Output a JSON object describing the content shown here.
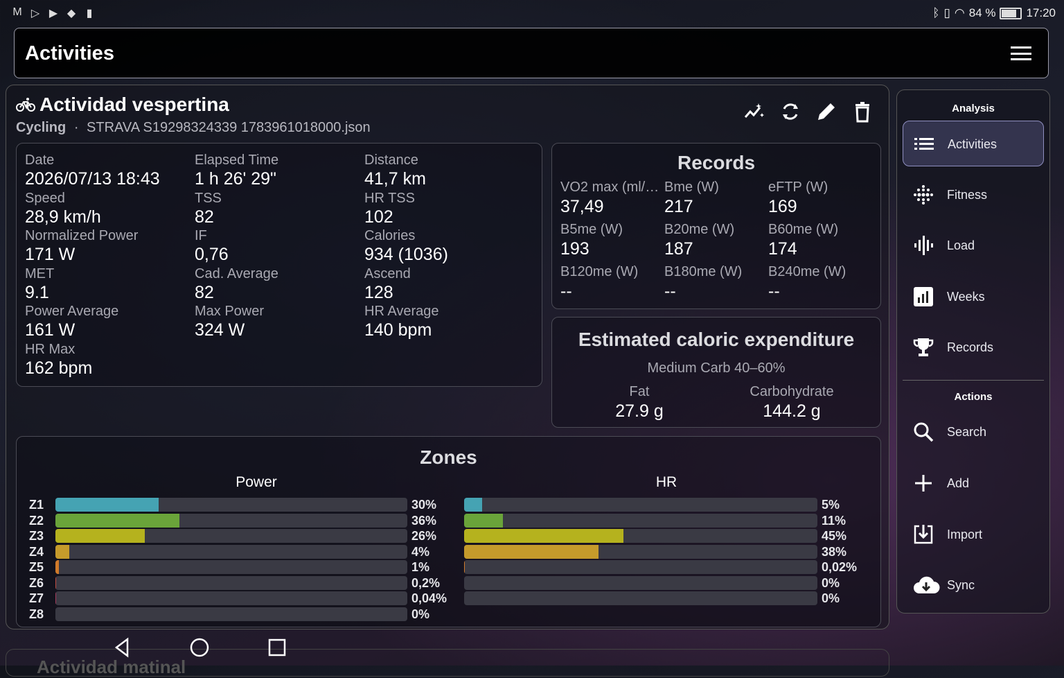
{
  "status_bar": {
    "battery": "84 %",
    "time": "17:20"
  },
  "app_bar": {
    "title": "Activities"
  },
  "activity": {
    "title": "Actividad vespertina",
    "sport": "Cycling",
    "separator": "·",
    "file": "STRAVA S19298324339 1783961018000.json",
    "stats": [
      {
        "label": "Date",
        "value": "2026/07/13 18:43"
      },
      {
        "label": "Elapsed Time",
        "value": "1 h 26' 29\""
      },
      {
        "label": "Distance",
        "value": "41,7 km"
      },
      {
        "label": "Speed",
        "value": "28,9 km/h"
      },
      {
        "label": "TSS",
        "value": "82"
      },
      {
        "label": "HR TSS",
        "value": "102"
      },
      {
        "label": "Normalized Power",
        "value": "171 W"
      },
      {
        "label": "IF",
        "value": "0,76"
      },
      {
        "label": "Calories",
        "value": "934 (1036)"
      },
      {
        "label": "MET",
        "value": "9.1"
      },
      {
        "label": "Cad. Average",
        "value": "82"
      },
      {
        "label": "Ascend",
        "value": "128"
      },
      {
        "label": "Power Average",
        "value": "161 W"
      },
      {
        "label": "Max Power",
        "value": "324 W"
      },
      {
        "label": "HR Average",
        "value": "140 bpm"
      },
      {
        "label": "HR Max",
        "value": "162 bpm"
      }
    ]
  },
  "records": {
    "title": "Records",
    "items": [
      {
        "label": "VO2 max (ml/…",
        "value": "37,49"
      },
      {
        "label": "Bme (W)",
        "value": "217"
      },
      {
        "label": "eFTP (W)",
        "value": "169"
      },
      {
        "label": "B5me (W)",
        "value": "193"
      },
      {
        "label": "B20me (W)",
        "value": "187"
      },
      {
        "label": "B60me (W)",
        "value": "174"
      },
      {
        "label": "B120me (W)",
        "value": "--"
      },
      {
        "label": "B180me (W)",
        "value": "--"
      },
      {
        "label": "B240me (W)",
        "value": "--"
      }
    ]
  },
  "caloric": {
    "title": "Estimated caloric expenditure",
    "subtitle": "Medium Carb 40–60%",
    "fat_label": "Fat",
    "fat_value": "27.9 g",
    "carb_label": "Carbohydrate",
    "carb_value": "144.2 g"
  },
  "zones": {
    "title": "Zones",
    "power_title": "Power",
    "hr_title": "HR",
    "colors": [
      "#45a3b3",
      "#6aa43a",
      "#b5b21e",
      "#c59b2b",
      "#d07a2a",
      "#c04a40",
      "#a33a5a",
      "#7a3a8a"
    ],
    "power": [
      {
        "zone": "Z1",
        "fraction": 0.3,
        "label": "30%"
      },
      {
        "zone": "Z2",
        "fraction": 0.36,
        "label": "36%"
      },
      {
        "zone": "Z3",
        "fraction": 0.26,
        "label": "26%"
      },
      {
        "zone": "Z4",
        "fraction": 0.04,
        "label": "4%"
      },
      {
        "zone": "Z5",
        "fraction": 0.01,
        "label": "1%"
      },
      {
        "zone": "Z6",
        "fraction": 0.002,
        "label": "0,2%"
      },
      {
        "zone": "Z7",
        "fraction": 0.0004,
        "label": "0,04%"
      },
      {
        "zone": "Z8",
        "fraction": 0,
        "label": "0%"
      }
    ],
    "hr": [
      {
        "fraction": 0.05,
        "label": "5%"
      },
      {
        "fraction": 0.11,
        "label": "11%"
      },
      {
        "fraction": 0.45,
        "label": "45%"
      },
      {
        "fraction": 0.38,
        "label": "38%"
      },
      {
        "fraction": 0.0002,
        "label": "0,02%"
      },
      {
        "fraction": 0,
        "label": "0%"
      },
      {
        "fraction": 0,
        "label": "0%"
      }
    ]
  },
  "sidebar": {
    "analysis_header": "Analysis",
    "actions_header": "Actions",
    "analysis_items": [
      {
        "label": "Activities",
        "icon": "list-icon"
      },
      {
        "label": "Fitness",
        "icon": "dots-icon"
      },
      {
        "label": "Load",
        "icon": "waveform-icon"
      },
      {
        "label": "Weeks",
        "icon": "bar-chart-icon"
      },
      {
        "label": "Records",
        "icon": "trophy-icon"
      }
    ],
    "action_items": [
      {
        "label": "Search",
        "icon": "search-icon"
      },
      {
        "label": "Add",
        "icon": "plus-icon"
      },
      {
        "label": "Import",
        "icon": "import-icon"
      },
      {
        "label": "Sync",
        "icon": "cloud-download-icon"
      }
    ]
  },
  "next_card": {
    "title": "Actividad matinal"
  }
}
